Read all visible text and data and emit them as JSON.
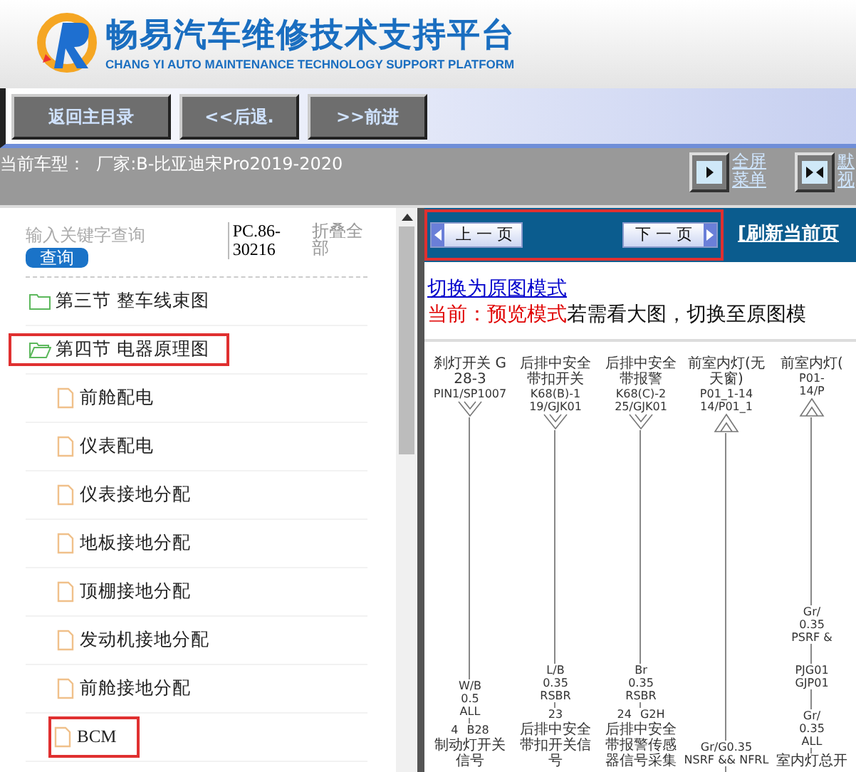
{
  "header": {
    "title": "畅易汽车维修技术支持平台",
    "subtitle": "CHANG YI AUTO MAINTENANCE TECHNOLOGY SUPPORT PLATFORM"
  },
  "toolbar": {
    "buttons": [
      "返回主目录",
      "<<后退.",
      ">>前进"
    ]
  },
  "info_bar": {
    "vehicle": "当前车型：  厂家:B-比亚迪宋Pro2019-2020",
    "buttons": [
      {
        "label": "全屏菜单",
        "kind": "expand"
      },
      {
        "label": "默视",
        "kind": "split"
      }
    ]
  },
  "sidebar": {
    "search": {
      "placeholder": "输入关键字查询",
      "button": "查询"
    },
    "part_number": "PC.86-30216",
    "collapse_link": "折叠全部",
    "tree": [
      {
        "label": "第三节 整车线束图",
        "expanded": false,
        "highlighted": false
      },
      {
        "label": "第四节 电器原理图",
        "expanded": true,
        "highlighted": true,
        "children": [
          {
            "label": "前舱配电",
            "highlighted": false
          },
          {
            "label": "仪表配电",
            "highlighted": false
          },
          {
            "label": "仪表接地分配",
            "highlighted": false
          },
          {
            "label": "地板接地分配",
            "highlighted": false
          },
          {
            "label": "顶棚接地分配",
            "highlighted": false
          },
          {
            "label": "发动机接地分配",
            "highlighted": false
          },
          {
            "label": "前舱接地分配",
            "highlighted": false
          },
          {
            "label": "BCM",
            "highlighted": true
          }
        ]
      }
    ]
  },
  "viewer": {
    "nav": {
      "highlighted": true,
      "prev": "上 一 页",
      "next": "下 一 页",
      "refresh": "[刷新当前页"
    },
    "mode_link": "切换为原图模式",
    "mode_label": "当前：预览模式",
    "mode_hint": "若需看大图，切换至原图模",
    "diagram": {
      "columns": [
        {
          "name": "刹灯开关 G28-3",
          "codes": [
            "PIN1/SP1007"
          ],
          "kind": "down",
          "wires": [
            [
              "W/B",
              "0.5",
              "ALL"
            ]
          ],
          "pin": "4",
          "pin_code": "B28",
          "signal": "制动灯开关信号"
        },
        {
          "name": "后排中安全带扣开关",
          "codes": [
            "K68(B)-1",
            "19/GJK01"
          ],
          "kind": "down",
          "wires": [
            [
              "L/B",
              "0.35",
              "RSBR"
            ]
          ],
          "pin": "23",
          "signal": "后排中安全带扣开关信号"
        },
        {
          "name": "后排中安全带报警",
          "codes": [
            "K68(C)-2",
            "25/GJK01"
          ],
          "kind": "down",
          "wires": [
            [
              "Br",
              "0.35",
              "RSBR"
            ]
          ],
          "pin": "24",
          "pin_code": "G2H",
          "signal": "后排中安全带报警传感器信号采集"
        },
        {
          "name": "前室内灯(无天窗)",
          "codes": [
            "P01_1-14",
            "14/P01_1"
          ],
          "kind": "up",
          "wires": [
            [
              "Gr/G0.35",
              "NSRF && NFRL"
            ]
          ]
        },
        {
          "name": "前室内灯(",
          "codes": [
            "P01-",
            "14/P"
          ],
          "kind": "up",
          "wires": [
            [
              "Gr/",
              "0.35",
              "PSRF &"
            ],
            [
              "PJG01",
              "GJP01"
            ],
            [
              "Gr/",
              "0.35",
              "ALL"
            ]
          ],
          "signal": "室内灯总开"
        }
      ]
    }
  }
}
